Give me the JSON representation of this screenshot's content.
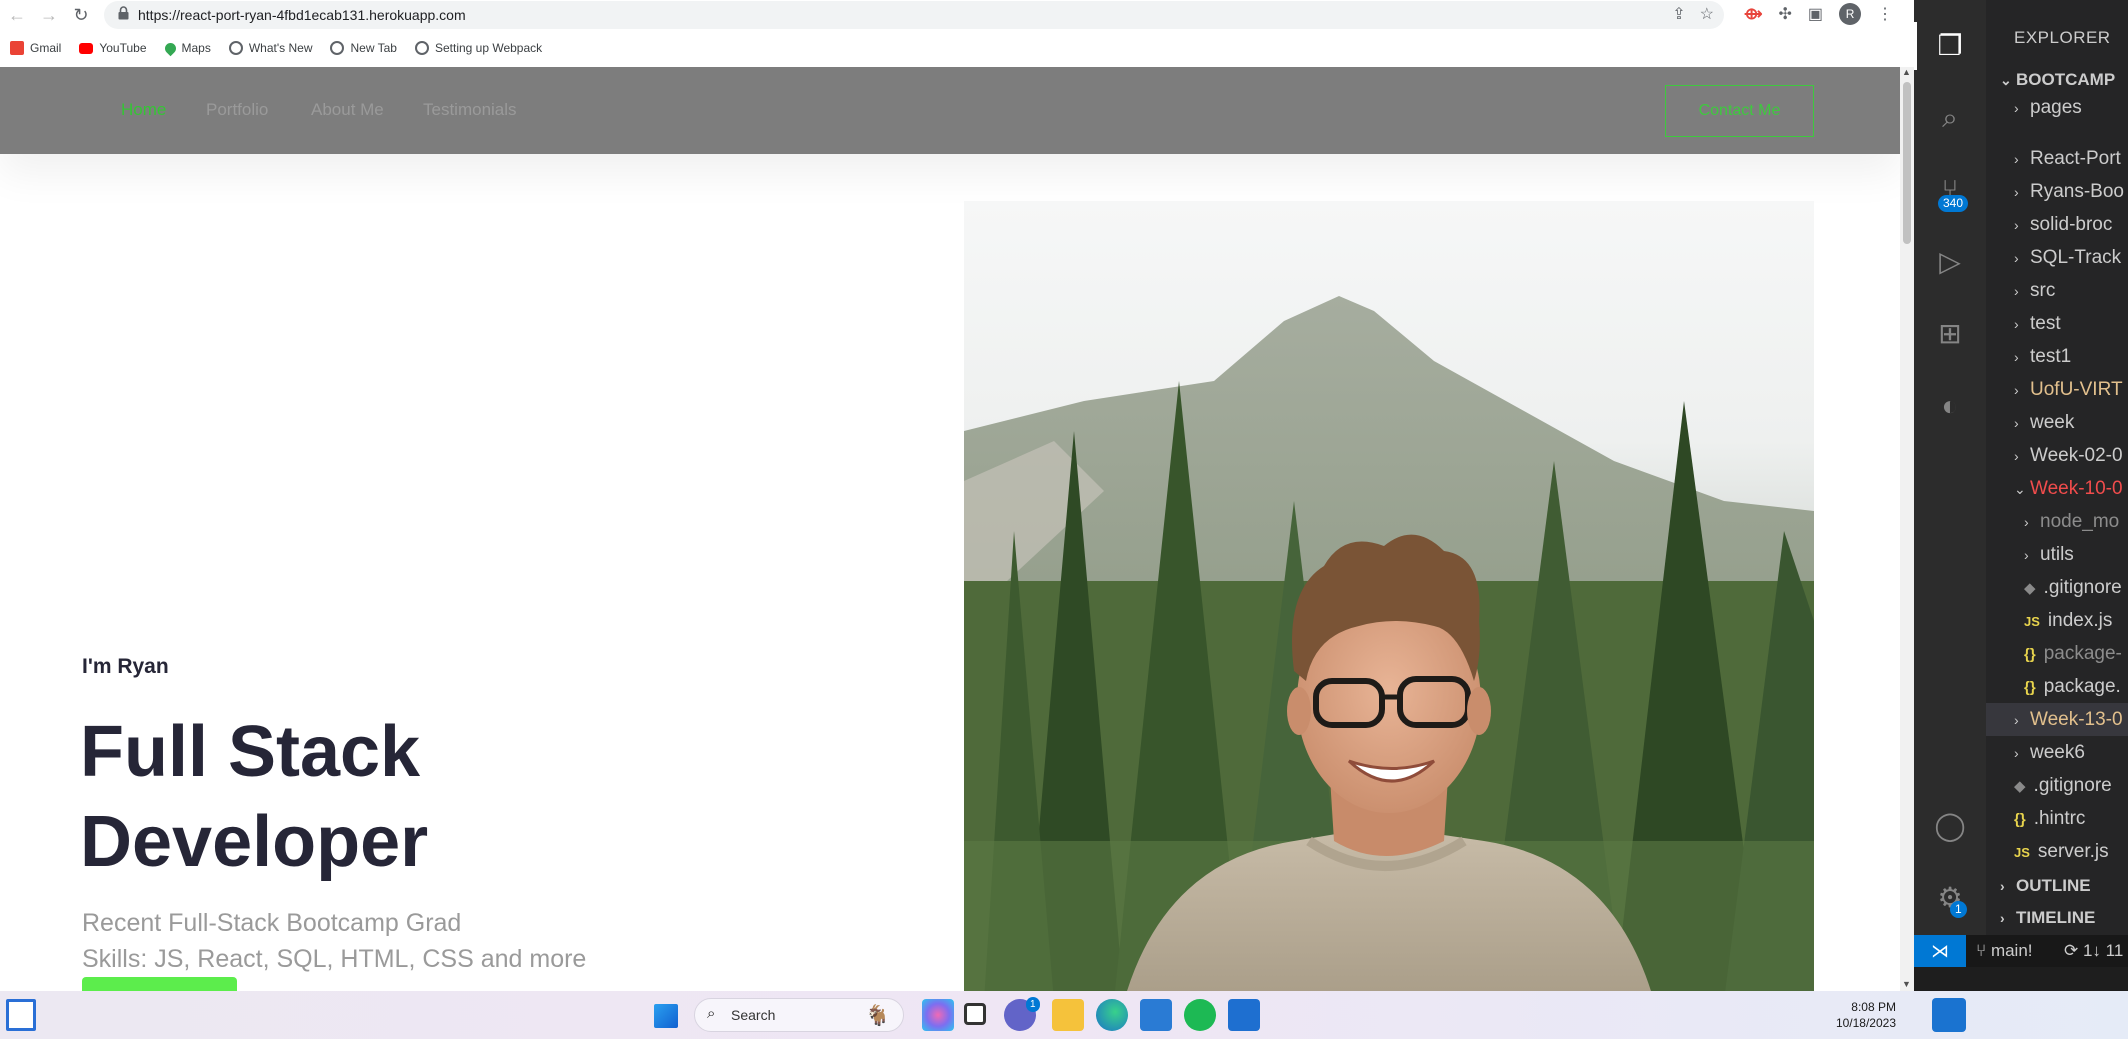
{
  "browser": {
    "url": "https://react-port-ryan-4fbd1ecab131.herokuapp.com",
    "profile_initial": "R",
    "bookmarks": [
      {
        "label": "Gmail",
        "icon": "gmail-icon",
        "color": "#ea4335"
      },
      {
        "label": "YouTube",
        "icon": "youtube-icon",
        "color": "#ff0000"
      },
      {
        "label": "Maps",
        "icon": "maps-icon",
        "color": "#34a853"
      },
      {
        "label": "What's New",
        "icon": "chrome-icon",
        "color": "#5f6368"
      },
      {
        "label": "New Tab",
        "icon": "globe-icon",
        "color": "#5f6368"
      },
      {
        "label": "Setting up Webpack",
        "icon": "globe-icon",
        "color": "#5f6368"
      }
    ]
  },
  "site": {
    "nav": {
      "links": [
        "Home",
        "Portfolio",
        "About Me",
        "Testimonials"
      ],
      "active": "Home",
      "contact_label": "Contact Me"
    },
    "hero": {
      "intro": "I'm Ryan",
      "title_line1": "Full Stack",
      "title_line2": "Developer",
      "subtitle_line1": "Recent Full-Stack Bootcamp Grad",
      "subtitle_line2": "Skills: JS, React, SQL, HTML, CSS and more"
    },
    "colors": {
      "accent": "#3ec93e",
      "nav_bg": "#7d7d7d",
      "heading": "#262637",
      "cta": "#5ced4c"
    }
  },
  "vscode": {
    "explorer_title": "EXPLORER",
    "workspace": "BOOTCAMP",
    "source_control_badge": "340",
    "settings_badge": "1",
    "tree": [
      {
        "label": "pages",
        "type": "folder",
        "color": "#cccccc",
        "indent": 0
      },
      {
        "label": "React-Port",
        "type": "folder",
        "color": "#cccccc",
        "indent": 0
      },
      {
        "label": "Ryans-Boo",
        "type": "folder",
        "color": "#cccccc",
        "indent": 0
      },
      {
        "label": "solid-broc",
        "type": "folder",
        "color": "#cccccc",
        "indent": 0
      },
      {
        "label": "SQL-Track",
        "type": "folder",
        "color": "#cccccc",
        "indent": 0
      },
      {
        "label": "src",
        "type": "folder",
        "color": "#cccccc",
        "indent": 0
      },
      {
        "label": "test",
        "type": "folder",
        "color": "#cccccc",
        "indent": 0
      },
      {
        "label": "test1",
        "type": "folder",
        "color": "#cccccc",
        "indent": 0
      },
      {
        "label": "UofU-VIRT",
        "type": "folder",
        "color": "#e2c08d",
        "indent": 0
      },
      {
        "label": "week",
        "type": "folder",
        "color": "#cccccc",
        "indent": 0
      },
      {
        "label": "Week-02-0",
        "type": "folder",
        "color": "#cccccc",
        "indent": 0
      },
      {
        "label": "Week-10-0",
        "type": "folder-open",
        "color": "#f14c4c",
        "indent": 0
      },
      {
        "label": "node_mo",
        "type": "folder",
        "color": "#8c8c8c",
        "indent": 1
      },
      {
        "label": "utils",
        "type": "folder",
        "color": "#cccccc",
        "indent": 1
      },
      {
        "label": ".gitignore",
        "type": "git",
        "color": "#cccccc",
        "indent": 1
      },
      {
        "label": "index.js",
        "type": "js",
        "color": "#cccccc",
        "indent": 1
      },
      {
        "label": "package-",
        "type": "json",
        "color": "#8c8c8c",
        "indent": 1
      },
      {
        "label": "package.",
        "type": "json",
        "color": "#cccccc",
        "indent": 1
      },
      {
        "label": "Week-13-0",
        "type": "folder",
        "color": "#e2c08d",
        "indent": 0,
        "selected": true
      },
      {
        "label": "week6",
        "type": "folder",
        "color": "#cccccc",
        "indent": 0
      },
      {
        "label": ".gitignore",
        "type": "git",
        "color": "#cccccc",
        "indent": 0
      },
      {
        "label": ".hintrc",
        "type": "json",
        "color": "#cccccc",
        "indent": 0
      },
      {
        "label": "server.js",
        "type": "js",
        "color": "#cccccc",
        "indent": 0
      }
    ],
    "outline": "OUTLINE",
    "timeline": "TIMELINE",
    "branch": "main!",
    "sync": "1↓ 11"
  },
  "taskbar": {
    "search_label": "Search",
    "time": "8:08 PM",
    "date": "10/18/2023",
    "chat_badge": "1"
  }
}
